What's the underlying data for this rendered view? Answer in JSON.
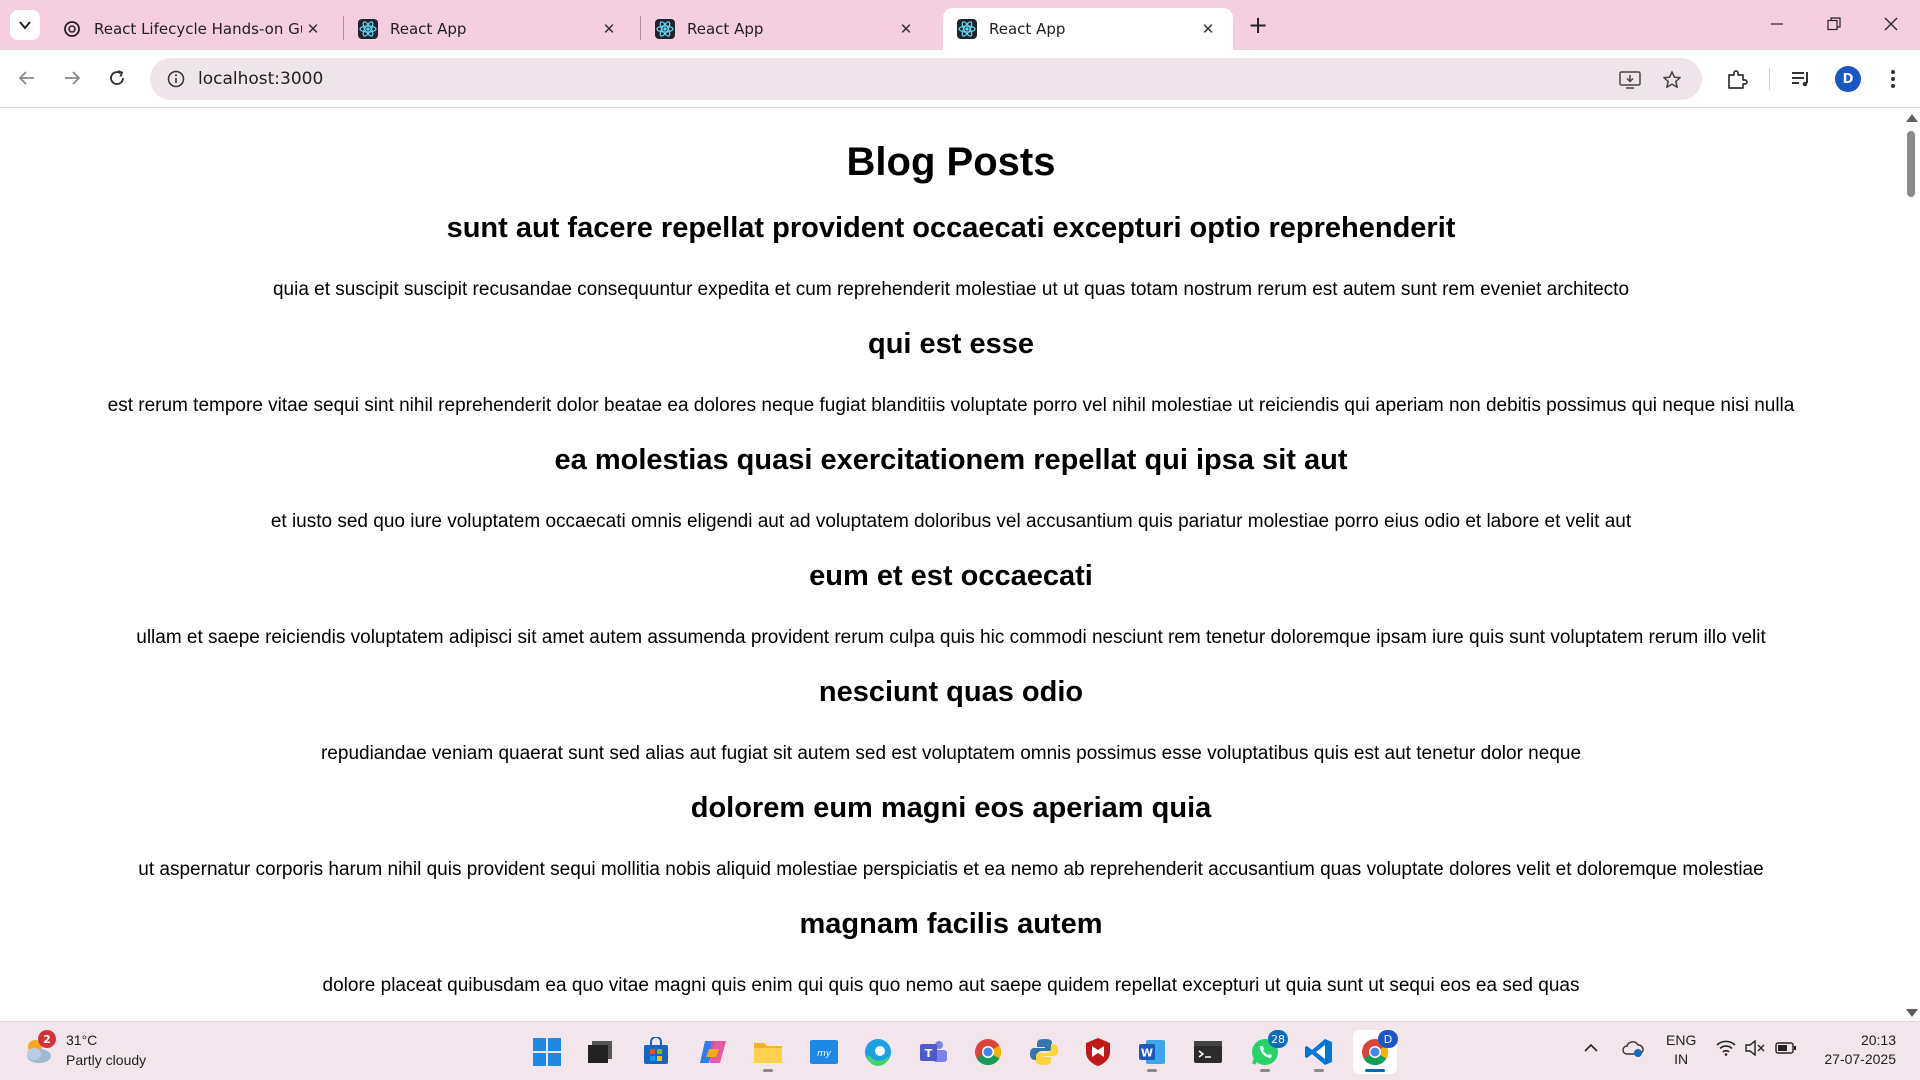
{
  "browser": {
    "tabs": [
      {
        "title": "React Lifecycle Hands-on Guide",
        "favicon": "chatgpt-icon",
        "active": false
      },
      {
        "title": "React App",
        "favicon": "react-icon",
        "active": false
      },
      {
        "title": "React App",
        "favicon": "react-icon",
        "active": false
      },
      {
        "title": "React App",
        "favicon": "react-icon",
        "active": true
      }
    ],
    "address": "localhost:3000",
    "profile_initial": "D",
    "accent_color": "#f5cfe0"
  },
  "page": {
    "title": "Blog Posts",
    "posts": [
      {
        "title": "sunt aut facere repellat provident occaecati excepturi optio reprehenderit",
        "body": "quia et suscipit suscipit recusandae consequuntur expedita et cum reprehenderit molestiae ut ut quas totam nostrum rerum est autem sunt rem eveniet architecto"
      },
      {
        "title": "qui est esse",
        "body": "est rerum tempore vitae sequi sint nihil reprehenderit dolor beatae ea dolores neque fugiat blanditiis voluptate porro vel nihil molestiae ut reiciendis qui aperiam non debitis possimus qui neque nisi nulla"
      },
      {
        "title": "ea molestias quasi exercitationem repellat qui ipsa sit aut",
        "body": "et iusto sed quo iure voluptatem occaecati omnis eligendi aut ad voluptatem doloribus vel accusantium quis pariatur molestiae porro eius odio et labore et velit aut"
      },
      {
        "title": "eum et est occaecati",
        "body": "ullam et saepe reiciendis voluptatem adipisci sit amet autem assumenda provident rerum culpa quis hic commodi nesciunt rem tenetur doloremque ipsam iure quis sunt voluptatem rerum illo velit"
      },
      {
        "title": "nesciunt quas odio",
        "body": "repudiandae veniam quaerat sunt sed alias aut fugiat sit autem sed est voluptatem omnis possimus esse voluptatibus quis est aut tenetur dolor neque"
      },
      {
        "title": "dolorem eum magni eos aperiam quia",
        "body": "ut aspernatur corporis harum nihil quis provident sequi mollitia nobis aliquid molestiae perspiciatis et ea nemo ab reprehenderit accusantium quas voluptate dolores velit et doloremque molestiae"
      },
      {
        "title": "magnam facilis autem",
        "body": "dolore placeat quibusdam ea quo vitae magni quis enim qui quis quo nemo aut saepe quidem repellat excepturi ut quia sunt ut sequi eos ea sed quas"
      }
    ]
  },
  "taskbar": {
    "weather": {
      "temp": "31°C",
      "condition": "Partly cloudy",
      "badge": "2"
    },
    "apps": [
      {
        "name": "windows-start-icon"
      },
      {
        "name": "task-view-icon"
      },
      {
        "name": "microsoft-store-icon"
      },
      {
        "name": "copilot-icon"
      },
      {
        "name": "file-explorer-icon"
      },
      {
        "name": "myhp-icon"
      },
      {
        "name": "edge-icon"
      },
      {
        "name": "teams-icon"
      },
      {
        "name": "chrome-icon"
      },
      {
        "name": "python-icon"
      },
      {
        "name": "mcafee-icon"
      },
      {
        "name": "word-icon"
      },
      {
        "name": "terminal-icon"
      },
      {
        "name": "whatsapp-icon",
        "badge": "28"
      },
      {
        "name": "vscode-icon"
      },
      {
        "name": "chrome-profile-icon",
        "badge": "D"
      }
    ],
    "language": {
      "line1": "ENG",
      "line2": "IN"
    },
    "clock": {
      "time": "20:13",
      "date": "27-07-2025"
    }
  }
}
